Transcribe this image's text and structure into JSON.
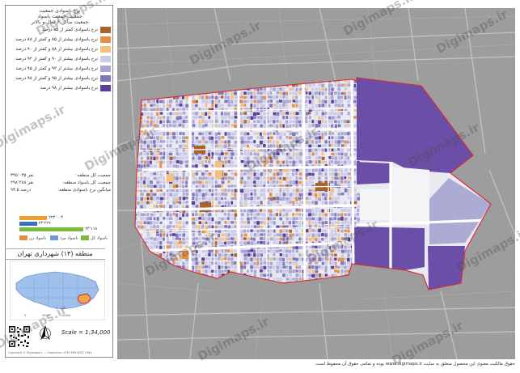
{
  "legend": {
    "title_line1": "نرخ باسوادی جمعیت",
    "title_line2": "جمعیت جمعیت باسواد",
    "title_line3": "جمعیت ساکن ۶ سال و بالاتر",
    "items": [
      {
        "label": "نرخ باسوادی کمتر از ۸۵ درصد",
        "color": "#a8642a"
      },
      {
        "label": "نرخ باسوادی بیشتر از ۸۵ و کمتر از ۸۸ درصد",
        "color": "#e98f45"
      },
      {
        "label": "نرخ باسوادی بیشتر از ۸۸ و کمتر از ۹۰ درصد",
        "color": "#f6c07b"
      },
      {
        "label": "نرخ باسوادی بیشتر از ۹۰ و کمتر از ۹۲ درصد",
        "color": "#cccbe6"
      },
      {
        "label": "نرخ باسوادی بیشتر از ۹۲ و کمتر از ۹۵ درصد",
        "color": "#a9a6d4"
      },
      {
        "label": "نرخ باسوادی بیشتر از ۹۵ و کمتر از ۹۸ درصد",
        "color": "#8078bc"
      },
      {
        "label": "نرخ باسوادی بیشتر از ۹۸ درصد",
        "color": "#5b3d9a"
      }
    ]
  },
  "stats": {
    "rows": [
      {
        "label": "جمعیت کل منطقه:",
        "value": "۳۴۵٬۰۳۵ نفر"
      },
      {
        "label": "جمعیت کل باسواد منطقه:",
        "value": "۲۹۸٬۲۸۸ نفر"
      },
      {
        "label": "میانگین نرخ باسوادی منطقه:",
        "value": "۹۳.۵ درصد"
      }
    ]
  },
  "bars": [
    {
      "value": "۲۲۳٬۰۰۳",
      "color": "#f0a030",
      "fraction": 0.38
    },
    {
      "value": "۲۳٬۲۲۹",
      "color": "#3b6fc2",
      "fraction": 0.24
    },
    {
      "value": "۴۳٬۱۱۸",
      "color": "#7dbb3a",
      "fraction": 0.88
    }
  ],
  "mini_legend": [
    {
      "label": "باسواد زن",
      "color": "#e98f45"
    },
    {
      "label": "باسواد مرد",
      "color": "#6e9ad6"
    },
    {
      "label": "باسواد کل",
      "color": "#7dbb3a"
    }
  ],
  "region_label": "منطقه (۱۴) شهرداری تهران",
  "scale_text": "Scale = 1:34,000",
  "credit_text": "Copyright © Digimaps.ir — Projection: UTM 39N WGS 1984",
  "footer_line1": "حقوق مالکیت معنوی این محصول متعلق به سایت www.digimaps.ir بوده و تمامی حقوق آن محفوظ است.",
  "watermark_text": "Digimaps.ir",
  "colors": {
    "boundary": "#e0262b",
    "basemap": "#9a9a9a",
    "road": "#d8d8d8",
    "accent_purple": "#6b4ea8"
  }
}
